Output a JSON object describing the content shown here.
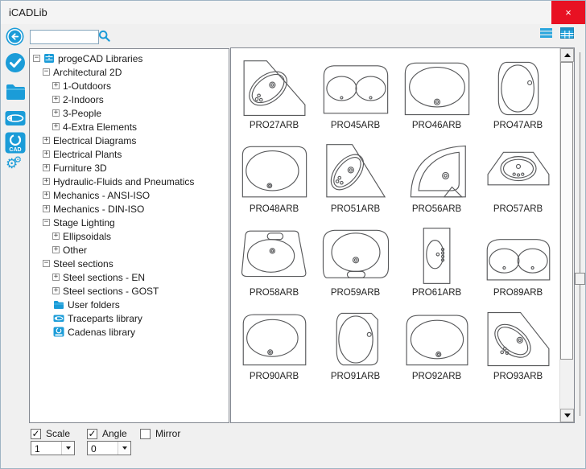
{
  "window": {
    "title": "iCADLib"
  },
  "titlebar": {
    "close_icon": "×"
  },
  "toolbar": {
    "search": {
      "value": "",
      "placeholder": ""
    },
    "icons": [
      "back-icon",
      "search-icon",
      "list-view-icon",
      "thumbnail-view-icon"
    ]
  },
  "left_toolbar": {
    "icons": [
      "back-icon",
      "check-insert-icon",
      "folder-icon",
      "traceparts-icon",
      "cadenas-cad-icon",
      "settings-gears-icon"
    ]
  },
  "tree": {
    "items": [
      {
        "label": "progeCAD Libraries",
        "level": 0,
        "expander": "minus",
        "icon": "library"
      },
      {
        "label": "Architectural 2D",
        "level": 1,
        "expander": "minus",
        "icon": null
      },
      {
        "label": "1-Outdoors",
        "level": 2,
        "expander": "plus",
        "icon": null
      },
      {
        "label": "2-Indoors",
        "level": 2,
        "expander": "plus",
        "icon": null
      },
      {
        "label": "3-People",
        "level": 2,
        "expander": "plus",
        "icon": null
      },
      {
        "label": "4-Extra Elements",
        "level": 2,
        "expander": "plus",
        "icon": null
      },
      {
        "label": "Electrical Diagrams",
        "level": 1,
        "expander": "plus",
        "icon": null
      },
      {
        "label": "Electrical Plants",
        "level": 1,
        "expander": "plus",
        "icon": null
      },
      {
        "label": "Furniture 3D",
        "level": 1,
        "expander": "plus",
        "icon": null
      },
      {
        "label": "Hydraulic-Fluids and Pneumatics",
        "level": 1,
        "expander": "plus",
        "icon": null
      },
      {
        "label": "Mechanics - ANSI-ISO",
        "level": 1,
        "expander": "plus",
        "icon": null
      },
      {
        "label": "Mechanics - DIN-ISO",
        "level": 1,
        "expander": "plus",
        "icon": null
      },
      {
        "label": "Stage Lighting",
        "level": 1,
        "expander": "minus",
        "icon": null
      },
      {
        "label": "Ellipsoidals",
        "level": 2,
        "expander": "plus",
        "icon": null
      },
      {
        "label": "Other",
        "level": 2,
        "expander": "plus",
        "icon": null
      },
      {
        "label": "Steel sections",
        "level": 1,
        "expander": "minus",
        "icon": null
      },
      {
        "label": "Steel sections - EN",
        "level": 2,
        "expander": "plus",
        "icon": null
      },
      {
        "label": "Steel sections - GOST",
        "level": 2,
        "expander": "plus",
        "icon": null
      },
      {
        "label": "User folders",
        "level": 1,
        "expander": "none",
        "icon": "folder"
      },
      {
        "label": "Traceparts library",
        "level": 1,
        "expander": "none",
        "icon": "traceparts"
      },
      {
        "label": "Cadenas library",
        "level": 1,
        "expander": "none",
        "icon": "cadenas"
      }
    ]
  },
  "thumbnails": {
    "items": [
      {
        "label": "PRO27ARB",
        "shape": "pro27"
      },
      {
        "label": "PRO45ARB",
        "shape": "pro45"
      },
      {
        "label": "PRO46ARB",
        "shape": "pro46"
      },
      {
        "label": "PRO47ARB",
        "shape": "pro47"
      },
      {
        "label": "PRO48ARB",
        "shape": "pro48"
      },
      {
        "label": "PRO51ARB",
        "shape": "pro51"
      },
      {
        "label": "PRO56ARB",
        "shape": "pro56"
      },
      {
        "label": "PRO57ARB",
        "shape": "pro57"
      },
      {
        "label": "PRO58ARB",
        "shape": "pro58"
      },
      {
        "label": "PRO59ARB",
        "shape": "pro59"
      },
      {
        "label": "PRO61ARB",
        "shape": "pro61"
      },
      {
        "label": "PRO89ARB",
        "shape": "pro89"
      },
      {
        "label": "PRO90ARB",
        "shape": "pro90"
      },
      {
        "label": "PRO91ARB",
        "shape": "pro91"
      },
      {
        "label": "PRO92ARB",
        "shape": "pro92"
      },
      {
        "label": "PRO93ARB",
        "shape": "pro93"
      }
    ]
  },
  "footer": {
    "scale": {
      "label": "Scale",
      "checked": true,
      "value": "1"
    },
    "angle": {
      "label": "Angle",
      "checked": true,
      "value": "0"
    },
    "mirror": {
      "label": "Mirror",
      "checked": false
    }
  },
  "colors": {
    "accent": "#1b9cd8",
    "close_button": "#e81123",
    "panel_border": "#828790",
    "drawing_stroke": "#58595b"
  }
}
